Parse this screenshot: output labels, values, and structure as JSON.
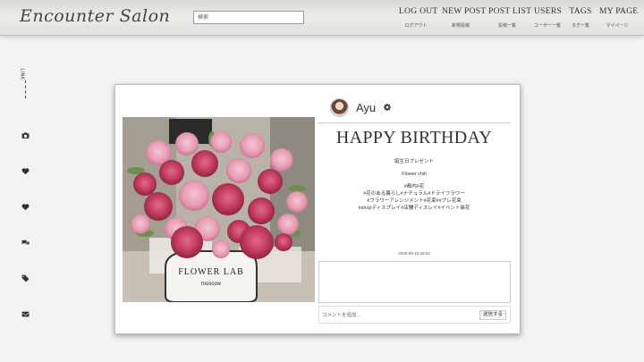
{
  "header": {
    "logo": "Encounter Salon",
    "search_placeholder": "検索",
    "nav": [
      {
        "label": "LOG OUT",
        "sub": "ログアウト"
      },
      {
        "label": "NEW POST",
        "sub": "新規投稿"
      },
      {
        "label": "POST LIST",
        "sub": "投稿一覧"
      },
      {
        "label": "USERS",
        "sub": "ユーザー一覧"
      },
      {
        "label": "TAGS",
        "sub": "タグ一覧"
      },
      {
        "label": "MY PAGE",
        "sub": "マイページ"
      }
    ]
  },
  "sidebar": {
    "link_label": "LINK",
    "icons": [
      "camera-icon",
      "heart-icon",
      "heart-outline-icon",
      "comments-icon",
      "tag-icon",
      "envelope-icon"
    ]
  },
  "post": {
    "author": "Ayu",
    "title": "HAPPY BIRTHDAY",
    "caption": "誕生日プレゼント",
    "shop": "Flower chill",
    "tags_line1": "#都内#花",
    "tags_line2": "#花のある暮らし#ナチュラル#ドライフラワー",
    "tags_line3": "#フラワーアレンジメント#花束##プレ花束",
    "tags_line4": "#shopディスプレイ#店舗ディスレイ#イベント装花",
    "timestamp": "2020-09-10 03:02",
    "photo_box_text": "FLOWER LAB",
    "photo_box_sub": "moscow",
    "comment_placeholder": "コメントを追加...",
    "submit_label": "送信する"
  },
  "colors": {
    "header_bg": "#e6e5e2",
    "page_bg": "#f3f3f3",
    "rose": "#c23b5c"
  }
}
